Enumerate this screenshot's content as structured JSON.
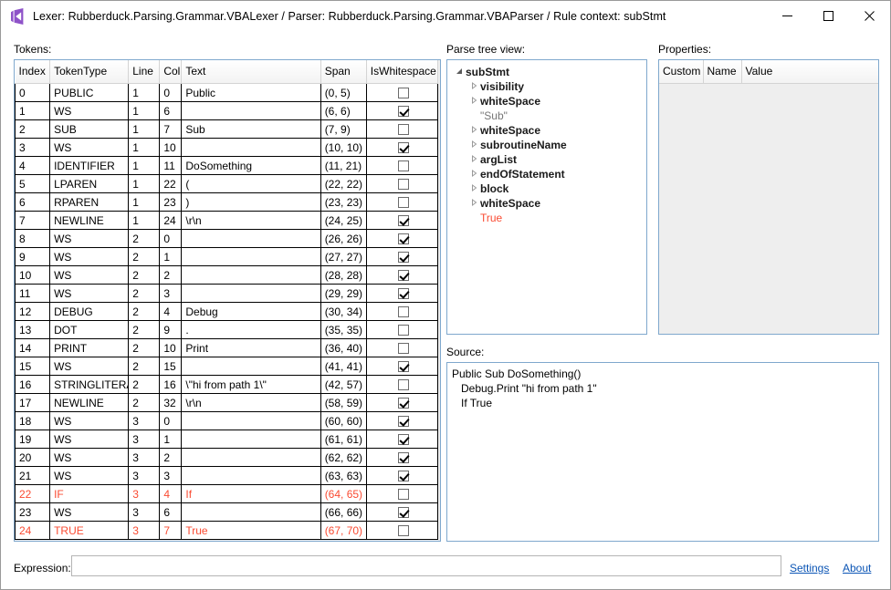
{
  "window": {
    "title": "Lexer: Rubberduck.Parsing.Grammar.VBALexer  /  Parser: Rubberduck.Parsing.Grammar.VBAParser  /  Rule context: subStmt",
    "icon": "rubberduck-app-icon",
    "minimize_label": "Minimize",
    "maximize_label": "Maximize",
    "close_label": "Close",
    "accent": "#7fa8cd",
    "error_color": "#fa4b32",
    "link_color": "#0b55b5"
  },
  "tokens": {
    "label": "Tokens:",
    "columns": [
      "Index",
      "TokenType",
      "Line",
      "Col",
      "Text",
      "Span",
      "IsWhitespace"
    ],
    "rows": [
      {
        "index": "0",
        "type": "PUBLIC",
        "line": "1",
        "col": "0",
        "text": "Public",
        "span": "(0, 5)",
        "ws": false,
        "error": false
      },
      {
        "index": "1",
        "type": "WS",
        "line": "1",
        "col": "6",
        "text": "",
        "span": "(6, 6)",
        "ws": true,
        "error": false
      },
      {
        "index": "2",
        "type": "SUB",
        "line": "1",
        "col": "7",
        "text": "Sub",
        "span": "(7, 9)",
        "ws": false,
        "error": false
      },
      {
        "index": "3",
        "type": "WS",
        "line": "1",
        "col": "10",
        "text": "",
        "span": "(10, 10)",
        "ws": true,
        "error": false
      },
      {
        "index": "4",
        "type": "IDENTIFIER",
        "line": "1",
        "col": "11",
        "text": "DoSomething",
        "span": "(11, 21)",
        "ws": false,
        "error": false
      },
      {
        "index": "5",
        "type": "LPAREN",
        "line": "1",
        "col": "22",
        "text": "(",
        "span": "(22, 22)",
        "ws": false,
        "error": false
      },
      {
        "index": "6",
        "type": "RPAREN",
        "line": "1",
        "col": "23",
        "text": ")",
        "span": "(23, 23)",
        "ws": false,
        "error": false
      },
      {
        "index": "7",
        "type": "NEWLINE",
        "line": "1",
        "col": "24",
        "text": "\\r\\n",
        "span": "(24, 25)",
        "ws": true,
        "error": false
      },
      {
        "index": "8",
        "type": "WS",
        "line": "2",
        "col": "0",
        "text": "",
        "span": "(26, 26)",
        "ws": true,
        "error": false
      },
      {
        "index": "9",
        "type": "WS",
        "line": "2",
        "col": "1",
        "text": "",
        "span": "(27, 27)",
        "ws": true,
        "error": false
      },
      {
        "index": "10",
        "type": "WS",
        "line": "2",
        "col": "2",
        "text": "",
        "span": "(28, 28)",
        "ws": true,
        "error": false
      },
      {
        "index": "11",
        "type": "WS",
        "line": "2",
        "col": "3",
        "text": "",
        "span": "(29, 29)",
        "ws": true,
        "error": false
      },
      {
        "index": "12",
        "type": "DEBUG",
        "line": "2",
        "col": "4",
        "text": "Debug",
        "span": "(30, 34)",
        "ws": false,
        "error": false
      },
      {
        "index": "13",
        "type": "DOT",
        "line": "2",
        "col": "9",
        "text": ".",
        "span": "(35, 35)",
        "ws": false,
        "error": false
      },
      {
        "index": "14",
        "type": "PRINT",
        "line": "2",
        "col": "10",
        "text": "Print",
        "span": "(36, 40)",
        "ws": false,
        "error": false
      },
      {
        "index": "15",
        "type": "WS",
        "line": "2",
        "col": "15",
        "text": "",
        "span": "(41, 41)",
        "ws": true,
        "error": false
      },
      {
        "index": "16",
        "type": "STRINGLITERAL",
        "line": "2",
        "col": "16",
        "text": "\\\"hi from path 1\\\"",
        "span": "(42, 57)",
        "ws": false,
        "error": false
      },
      {
        "index": "17",
        "type": "NEWLINE",
        "line": "2",
        "col": "32",
        "text": "\\r\\n",
        "span": "(58, 59)",
        "ws": true,
        "error": false
      },
      {
        "index": "18",
        "type": "WS",
        "line": "3",
        "col": "0",
        "text": "",
        "span": "(60, 60)",
        "ws": true,
        "error": false
      },
      {
        "index": "19",
        "type": "WS",
        "line": "3",
        "col": "1",
        "text": "",
        "span": "(61, 61)",
        "ws": true,
        "error": false
      },
      {
        "index": "20",
        "type": "WS",
        "line": "3",
        "col": "2",
        "text": "",
        "span": "(62, 62)",
        "ws": true,
        "error": false
      },
      {
        "index": "21",
        "type": "WS",
        "line": "3",
        "col": "3",
        "text": "",
        "span": "(63, 63)",
        "ws": true,
        "error": false
      },
      {
        "index": "22",
        "type": "IF",
        "line": "3",
        "col": "4",
        "text": "If",
        "span": "(64, 65)",
        "ws": false,
        "error": true
      },
      {
        "index": "23",
        "type": "WS",
        "line": "3",
        "col": "6",
        "text": "",
        "span": "(66, 66)",
        "ws": true,
        "error": false
      },
      {
        "index": "24",
        "type": "TRUE",
        "line": "3",
        "col": "7",
        "text": "True",
        "span": "(67, 70)",
        "ws": false,
        "error": true
      }
    ]
  },
  "parse_tree": {
    "label": "Parse tree view:",
    "nodes": [
      {
        "label": "subStmt",
        "depth": 0,
        "kind": "rule",
        "state": "expanded"
      },
      {
        "label": "visibility",
        "depth": 1,
        "kind": "rule",
        "state": "collapsed"
      },
      {
        "label": "whiteSpace",
        "depth": 1,
        "kind": "rule",
        "state": "collapsed"
      },
      {
        "label": "\"Sub\"",
        "depth": 1,
        "kind": "terminal",
        "state": "leaf"
      },
      {
        "label": "whiteSpace",
        "depth": 1,
        "kind": "rule",
        "state": "collapsed"
      },
      {
        "label": "subroutineName",
        "depth": 1,
        "kind": "rule",
        "state": "collapsed"
      },
      {
        "label": "argList",
        "depth": 1,
        "kind": "rule",
        "state": "collapsed"
      },
      {
        "label": "endOfStatement",
        "depth": 1,
        "kind": "rule",
        "state": "collapsed"
      },
      {
        "label": "block",
        "depth": 1,
        "kind": "rule",
        "state": "collapsed"
      },
      {
        "label": "whiteSpace",
        "depth": 1,
        "kind": "rule",
        "state": "collapsed"
      },
      {
        "label": "True",
        "depth": 1,
        "kind": "error",
        "state": "leaf"
      }
    ]
  },
  "properties": {
    "label": "Properties:",
    "columns": [
      "Custom",
      "Name",
      "Value"
    ],
    "rows": []
  },
  "source": {
    "label": "Source:",
    "code": "Public Sub DoSomething()\n   Debug.Print \"hi from path 1\"\n   If True"
  },
  "footer": {
    "expression_label": "Expression:",
    "expression_value": "",
    "expression_placeholder": "",
    "settings_label": "Settings",
    "about_label": "About"
  }
}
